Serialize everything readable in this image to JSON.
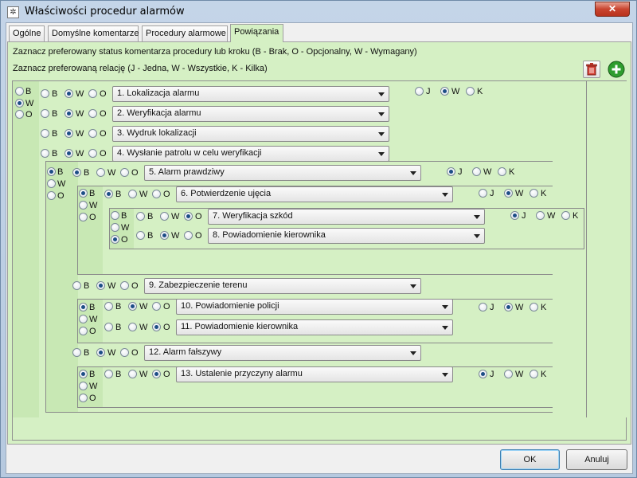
{
  "window": {
    "title": "Właściwości procedur alarmów",
    "close_glyph": "✕"
  },
  "tabs": [
    "Ogólne",
    "Domyślne komentarze",
    "Procedury alarmowe",
    "Powiązania"
  ],
  "active_tab": 3,
  "hints": {
    "status": "Zaznacz preferowany status komentarza procedury lub kroku (B - Brak, O - Opcjonalny, W - Wymagany)",
    "relation": "Zaznacz preferowaną relację (J - Jedna, W - Wszystkie, K - Kilka)"
  },
  "toolbar": {
    "delete_icon": "trash-icon",
    "add_icon": "plus-icon"
  },
  "status_opts": [
    "B",
    "W",
    "O"
  ],
  "relation_opts": [
    "J",
    "W",
    "K"
  ],
  "groups": [
    {
      "sel": 1,
      "relation": 1
    },
    {
      "sel": 0,
      "relation": 0
    },
    {
      "sel": 0,
      "relation": 1
    },
    {
      "sel": 2,
      "relation": 0
    },
    {
      "sel": 0,
      "relation": 1
    },
    {
      "sel": 0,
      "relation": 0
    }
  ],
  "rows": [
    {
      "label": "1. Lokalizacja alarmu",
      "status": 1
    },
    {
      "label": "2. Weryfikacja alarmu",
      "status": 1
    },
    {
      "label": "3. Wydruk lokalizacji",
      "status": 1
    },
    {
      "label": "4. Wysłanie patrolu w celu weryfikacji",
      "status": 1
    },
    {
      "label": "5. Alarm prawdziwy",
      "status": 0
    },
    {
      "label": "6. Potwierdzenie ujęcia",
      "status": 0
    },
    {
      "label": "7. Weryfikacja szkód",
      "status": 2
    },
    {
      "label": "8. Powiadomienie kierownika",
      "status": 1
    },
    {
      "label": "9. Zabezpieczenie terenu",
      "status": 1
    },
    {
      "label": "10. Powiadomienie policji",
      "status": 1
    },
    {
      "label": "11. Powiadomienie kierownika",
      "status": 2
    },
    {
      "label": "12. Alarm fałszywy",
      "status": 1
    },
    {
      "label": "13. Ustalenie przyczyny alarmu",
      "status": 2
    }
  ],
  "buttons": {
    "ok": "OK",
    "cancel": "Anuluj"
  }
}
